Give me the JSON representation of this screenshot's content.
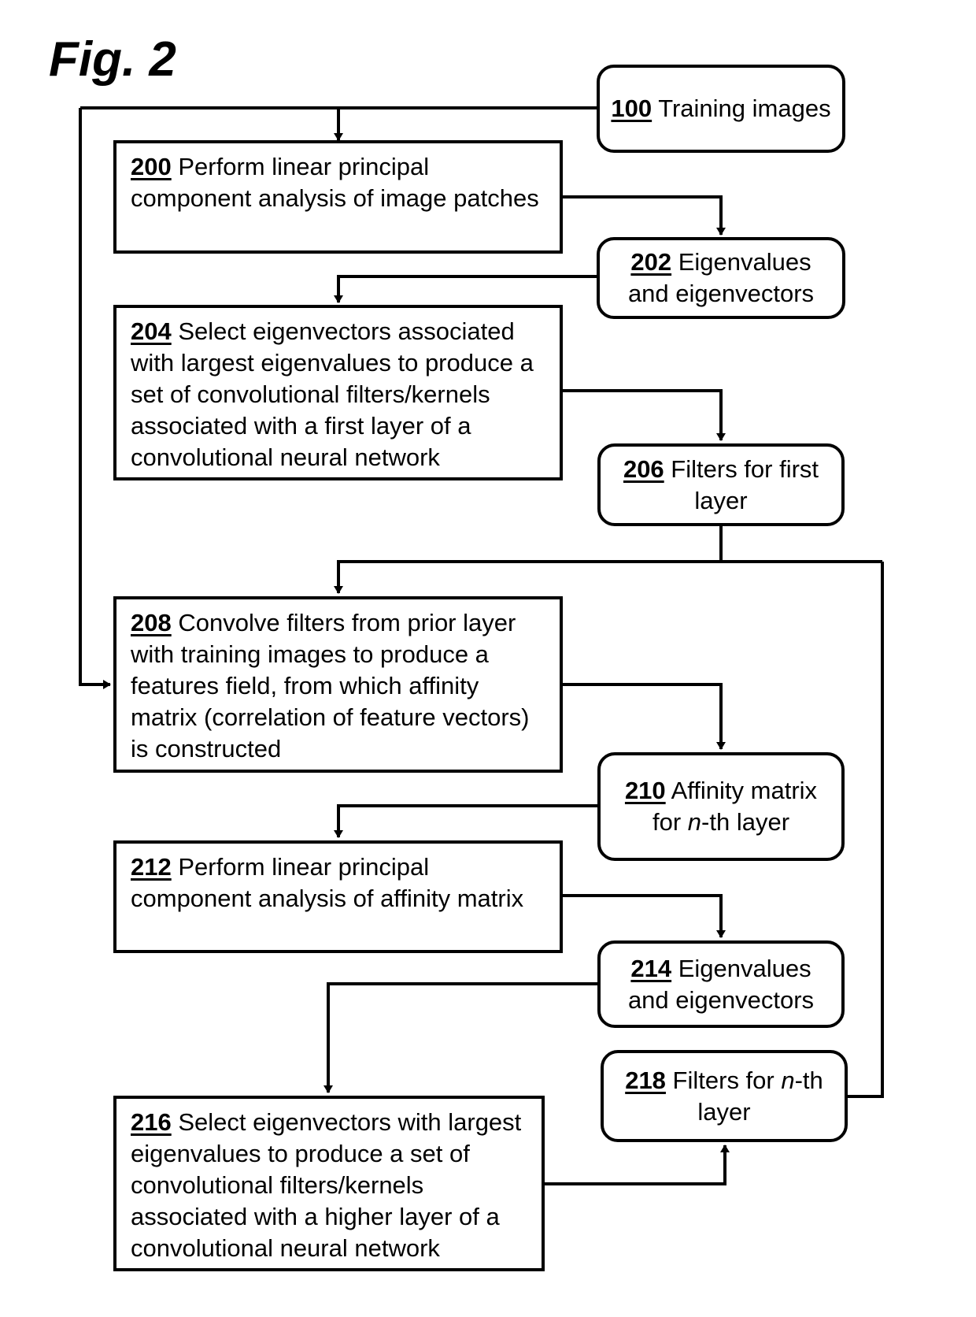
{
  "figure": {
    "title": "Fig. 2",
    "nodes": {
      "n100": {
        "ref": "100",
        "text": " Training images"
      },
      "n200": {
        "ref": "200",
        "text": " Perform linear principal component analysis of image patches"
      },
      "n202": {
        "ref": "202",
        "text": " Eigenvalues and eigenvectors"
      },
      "n204": {
        "ref": "204",
        "text": " Select eigenvectors associated with largest eigenvalues to produce a set of convolutional filters/kernels associated with a first layer of a convolutional neural network"
      },
      "n206": {
        "ref": "206",
        "text": " Filters for first layer"
      },
      "n208": {
        "ref": "208",
        "text": " Convolve filters from prior layer with training images to produce a features field, from which affinity matrix (correlation of feature vectors) is constructed"
      },
      "n210": {
        "ref": "210",
        "pre": " Affinity matrix for ",
        "italic": "n",
        "post": "-th layer"
      },
      "n212": {
        "ref": "212",
        "text": " Perform linear principal component analysis of affinity matrix"
      },
      "n214": {
        "ref": "214",
        "text": " Eigenvalues and eigenvectors"
      },
      "n216": {
        "ref": "216",
        "text": " Select eigenvectors with largest eigenvalues to produce a set of convolutional filters/kernels associated with a higher layer of a convolutional neural network"
      },
      "n218": {
        "ref": "218",
        "pre": " Filters for ",
        "italic": "n",
        "post": "-th layer"
      }
    },
    "edges": [
      {
        "from": "100",
        "to": "200"
      },
      {
        "from": "100",
        "to": "208"
      },
      {
        "from": "200",
        "to": "202"
      },
      {
        "from": "202",
        "to": "204"
      },
      {
        "from": "204",
        "to": "206"
      },
      {
        "from": "206",
        "to": "208"
      },
      {
        "from": "208",
        "to": "210"
      },
      {
        "from": "210",
        "to": "212"
      },
      {
        "from": "212",
        "to": "214"
      },
      {
        "from": "214",
        "to": "216"
      },
      {
        "from": "216",
        "to": "218"
      },
      {
        "from": "218",
        "to": "208"
      }
    ]
  }
}
